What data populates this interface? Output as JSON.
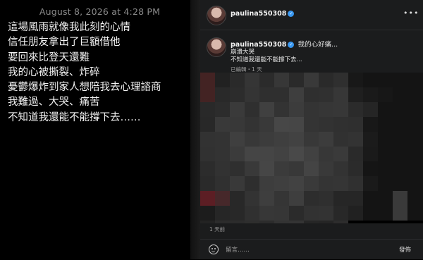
{
  "note": {
    "timestamp": "August 8, 2026 at 4:28 PM",
    "lines": [
      "這場風雨就像我此刻的心情",
      "信任朋友拿出了巨額借他",
      "要回來比登天還難",
      "我的心被撕裂、炸碎",
      "憂鬱爆炸到家人想陪我去心理諮商",
      "我難過、大哭、痛苦",
      "不知道我還能不能撐下去……"
    ]
  },
  "post": {
    "header": {
      "username": "paulina550308",
      "more_icon": "more-horizontal-icon"
    },
    "caption": {
      "username": "paulina550308",
      "lines": [
        "我的心好痛...",
        "崩潰大哭",
        "不知道我還能不能撐下去..."
      ],
      "meta": "已編輯・1 天"
    },
    "time_ago": "1 天前",
    "comment": {
      "emoji_icon": "smiley-icon",
      "placeholder": "留言……",
      "post_label": "發佈"
    },
    "colors": {
      "panel_bg": "#1b1c1d",
      "verified": "#3897f0"
    }
  }
}
